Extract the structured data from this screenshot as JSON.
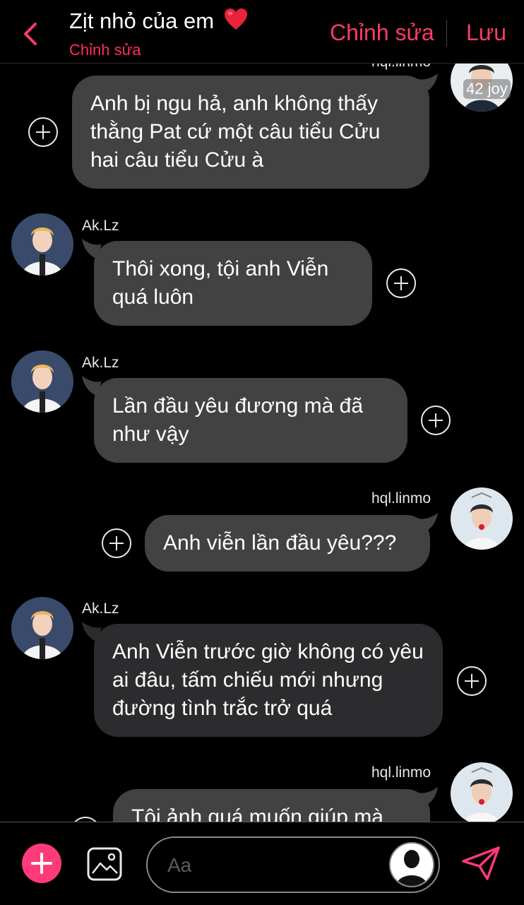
{
  "header": {
    "title": "Zịt nhỏ của em",
    "subtitle": "Chỉnh sửa",
    "edit_label": "Chỉnh sửa",
    "save_label": "Lưu",
    "accent": "#ff3a67"
  },
  "chat": {
    "top_partial_badge": "42 joy",
    "messages": [
      {
        "sender": "hql.linmo",
        "side": "right",
        "text": "Anh bị ngu hả, anh không thấy thằng Pat cứ một câu tiểu Cửu hai câu tiểu Cửu à"
      },
      {
        "sender": "Ak.Lz",
        "side": "left",
        "text": "Thôi xong, tội anh Viễn quá luôn"
      },
      {
        "sender": "Ak.Lz",
        "side": "left",
        "text": "Lần đầu yêu đương mà đã như vậy"
      },
      {
        "sender": "hql.linmo",
        "side": "right",
        "text": "Anh viễn lần đầu yêu???"
      },
      {
        "sender": "Ak.Lz",
        "side": "left",
        "text": "Anh Viễn trước giờ không có yêu ai đâu, tấm chiếu mới nhưng đường tình trắc trở quá"
      },
      {
        "sender": "hql.linmo",
        "side": "right",
        "text": "Tội ảnh quá muốn giúp mà"
      }
    ]
  },
  "composer": {
    "placeholder": "Aa",
    "add_icon": "plus-icon",
    "image_icon": "image-icon",
    "send_icon": "send-icon",
    "accent": "#ff3a79"
  }
}
